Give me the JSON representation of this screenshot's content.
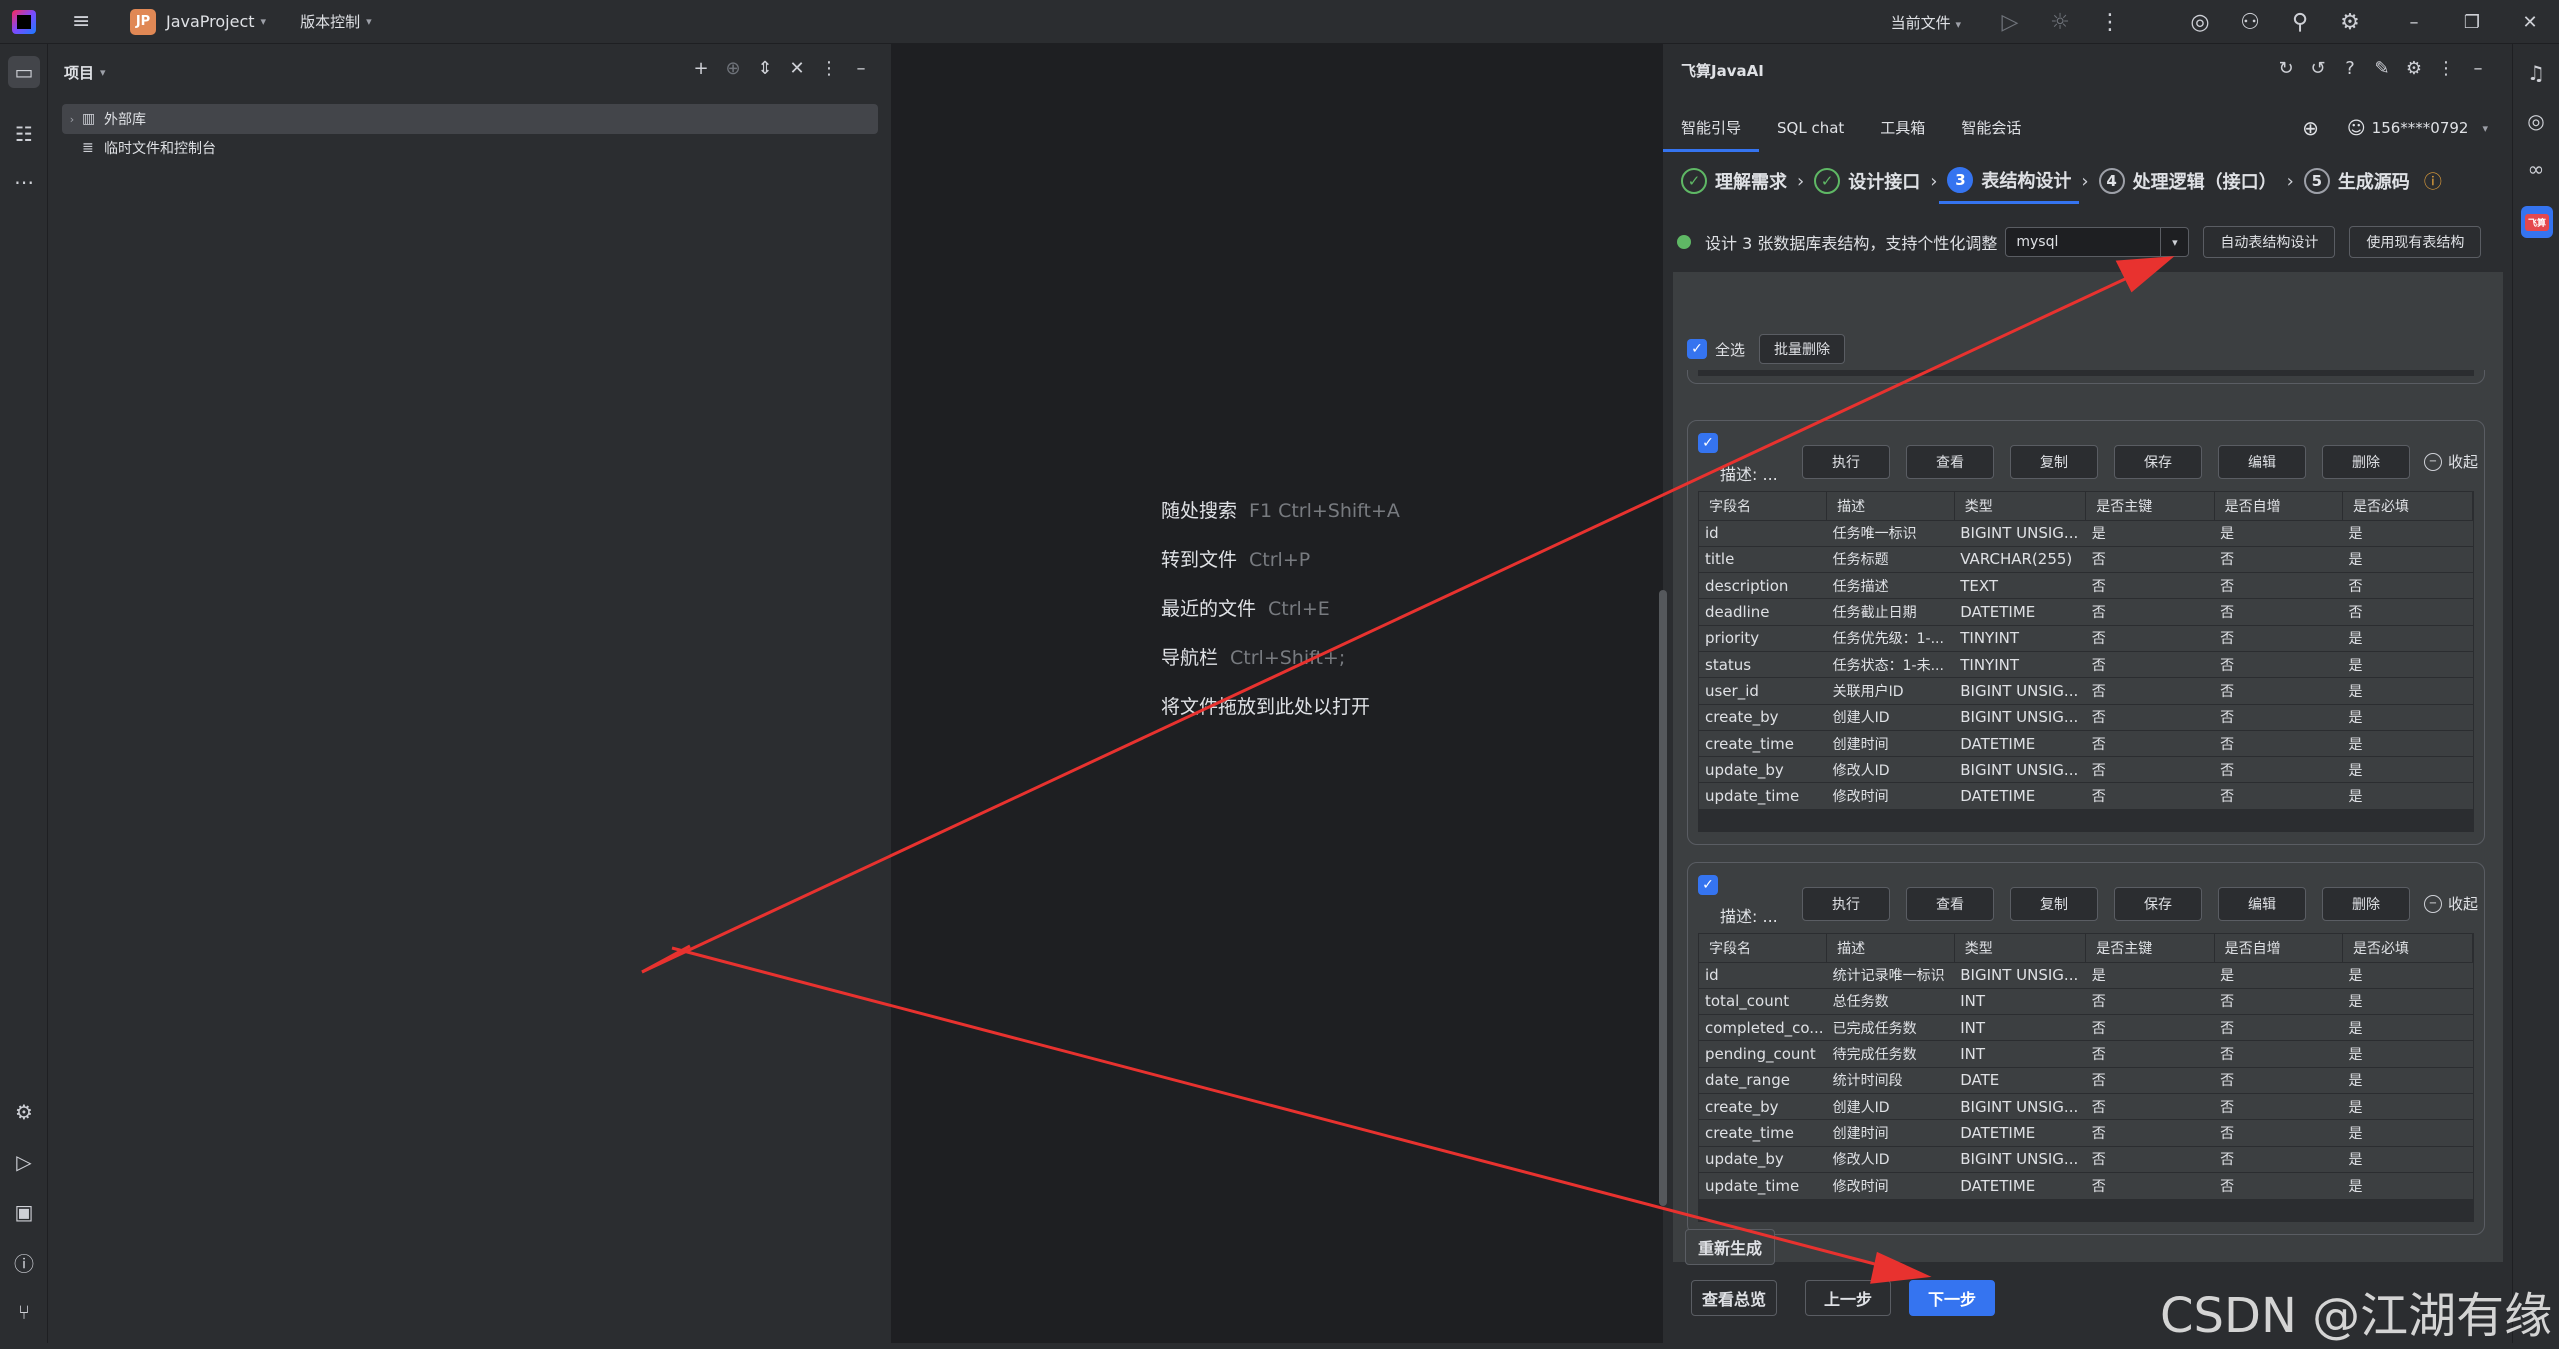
{
  "titlebar": {
    "project_badge": "JP",
    "project_name": "JavaProject",
    "vcs_label": "版本控制",
    "current_file": "当前文件"
  },
  "project_panel": {
    "title": "项目",
    "tree": [
      {
        "label": "外部库"
      },
      {
        "label": "临时文件和控制台"
      }
    ]
  },
  "editor": {
    "hints": [
      {
        "label": "随处搜索",
        "key": "F1 Ctrl+Shift+A"
      },
      {
        "label": "转到文件",
        "key": "Ctrl+P"
      },
      {
        "label": "最近的文件",
        "key": "Ctrl+E"
      },
      {
        "label": "导航栏",
        "key": "Ctrl+Shift+;"
      },
      {
        "label": "将文件拖放到此处以打开",
        "key": ""
      }
    ]
  },
  "ai_panel": {
    "title": "飞算JavaAI",
    "tabs": [
      "智能引导",
      "SQL chat",
      "工具箱",
      "智能会话"
    ],
    "account": "156****0792",
    "steps": [
      {
        "num": "✓",
        "label": "理解需求",
        "state": "done"
      },
      {
        "num": "✓",
        "label": "设计接口",
        "state": "done"
      },
      {
        "num": "3",
        "label": "表结构设计",
        "state": "current"
      },
      {
        "num": "4",
        "label": "处理逻辑（接口）",
        "state": "todo"
      },
      {
        "num": "5",
        "label": "生成源码",
        "state": "todo"
      }
    ],
    "info_text": "设计 3 张数据库表结构，支持个性化调整",
    "db_type": "mysql",
    "auto_design_btn": "自动表结构设计",
    "use_existing_btn": "使用现有表结构",
    "select_all": "全选",
    "batch_delete": "批量删除",
    "card_desc": "描述: ...",
    "card_buttons": [
      "执行",
      "查看",
      "复制",
      "保存",
      "编辑",
      "删除"
    ],
    "collapse": "收起",
    "columns": [
      "字段名",
      "描述",
      "类型",
      "是否主键",
      "是否自增",
      "是否必填"
    ],
    "tables": [
      {
        "rows": [
          [
            "id",
            "任务唯一标识",
            "BIGINT UNSIG...",
            "是",
            "是",
            "是"
          ],
          [
            "title",
            "任务标题",
            "VARCHAR(255)",
            "否",
            "否",
            "是"
          ],
          [
            "description",
            "任务描述",
            "TEXT",
            "否",
            "否",
            "否"
          ],
          [
            "deadline",
            "任务截止日期",
            "DATETIME",
            "否",
            "否",
            "否"
          ],
          [
            "priority",
            "任务优先级：1-...",
            "TINYINT",
            "否",
            "否",
            "是"
          ],
          [
            "status",
            "任务状态：1-未...",
            "TINYINT",
            "否",
            "否",
            "是"
          ],
          [
            "user_id",
            "关联用户ID",
            "BIGINT UNSIG...",
            "否",
            "否",
            "是"
          ],
          [
            "create_by",
            "创建人ID",
            "BIGINT UNSIG...",
            "否",
            "否",
            "是"
          ],
          [
            "create_time",
            "创建时间",
            "DATETIME",
            "否",
            "否",
            "是"
          ],
          [
            "update_by",
            "修改人ID",
            "BIGINT UNSIG...",
            "否",
            "否",
            "是"
          ],
          [
            "update_time",
            "修改时间",
            "DATETIME",
            "否",
            "否",
            "是"
          ]
        ]
      },
      {
        "rows": [
          [
            "id",
            "统计记录唯一标识",
            "BIGINT UNSIG...",
            "是",
            "是",
            "是"
          ],
          [
            "total_count",
            "总任务数",
            "INT",
            "否",
            "否",
            "是"
          ],
          [
            "completed_co...",
            "已完成任务数",
            "INT",
            "否",
            "否",
            "是"
          ],
          [
            "pending_count",
            "待完成任务数",
            "INT",
            "否",
            "否",
            "是"
          ],
          [
            "date_range",
            "统计时间段",
            "DATE",
            "否",
            "否",
            "是"
          ],
          [
            "create_by",
            "创建人ID",
            "BIGINT UNSIG...",
            "否",
            "否",
            "是"
          ],
          [
            "create_time",
            "创建时间",
            "DATETIME",
            "否",
            "否",
            "是"
          ],
          [
            "update_by",
            "修改人ID",
            "BIGINT UNSIG...",
            "否",
            "否",
            "是"
          ],
          [
            "update_time",
            "修改时间",
            "DATETIME",
            "否",
            "否",
            "是"
          ]
        ]
      }
    ],
    "regenerate": "重新生成",
    "view_overview": "查看总览",
    "prev_step": "上一步",
    "next_step": "下一步"
  },
  "watermark": "CSDN @江湖有缘",
  "colors": {
    "accent": "#3574f0",
    "success": "#5fb865",
    "annotation": "#e8322f"
  }
}
